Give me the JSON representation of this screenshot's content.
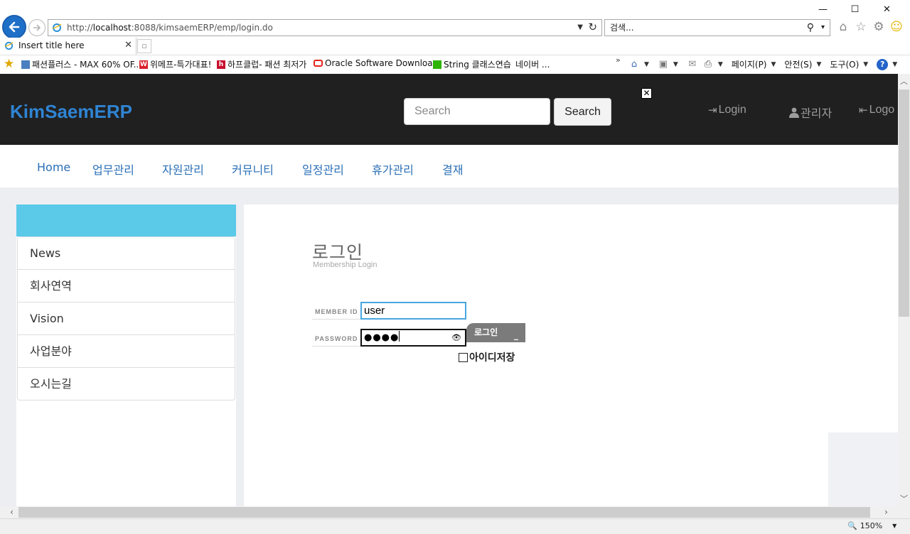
{
  "window": {
    "minimize": "—",
    "maximize": "☐",
    "close": "✕"
  },
  "address": {
    "prefix": "http://",
    "host": "localhost",
    "rest": ":8088/kimsaemERP/emp/login.do"
  },
  "search_bar": {
    "placeholder": "검색..."
  },
  "tab": {
    "title": "Insert title here"
  },
  "favorites": [
    {
      "label": "패션플러스 - MAX 60% OF...",
      "icon": "page-icon",
      "color": "#4a7fc1"
    },
    {
      "label": "위메프-특가대표!",
      "icon": "wemakeprice-icon",
      "color": "#d9232d"
    },
    {
      "label": "하프클럽- 패션 최저가",
      "icon": "halfclub-icon",
      "color": "#c7102e"
    },
    {
      "label": "Oracle Software Downloa...",
      "icon": "oracle-icon",
      "color": "#e2231a"
    },
    {
      "label": "String 클래스연습",
      "icon": "naver-icon",
      "color": "#2db400"
    },
    {
      "label": "네이버 ...",
      "icon": "",
      "color": ""
    }
  ],
  "command_bar": {
    "page": "페이지(P)",
    "safety": "안전(S)",
    "tools": "도구(O)"
  },
  "site": {
    "brand": "KimSaemERP",
    "search_placeholder": "Search",
    "search_button": "Search",
    "nav": {
      "login": "Login",
      "admin": "관리자",
      "logout": "Logo"
    },
    "menu": [
      "Home",
      "업무관리",
      "자원관리",
      "커뮤니티",
      "일정관리",
      "휴가관리",
      "결재"
    ],
    "sidebar": [
      "News",
      "회사연역",
      "Vision",
      "사업분야",
      "오시는길"
    ],
    "login": {
      "title": "로그인",
      "subtitle": "Membership Login",
      "id_label": "MEMBER ID",
      "id_value": "user",
      "pw_label": "PASSWORD",
      "pw_value": "●●●●",
      "button": "로그인",
      "remember": "아이디저장"
    }
  },
  "status": {
    "zoom": "150%"
  },
  "colors": {
    "brand": "#2f84d3",
    "topbar": "#202020",
    "menu_link": "#2a6fb6",
    "sidebar_header": "#5bc9e8"
  }
}
